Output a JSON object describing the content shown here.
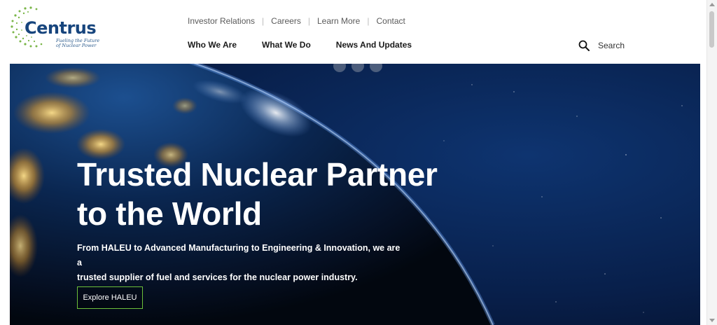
{
  "brand": {
    "name": "Centrus",
    "tagline_line1": "Fueling the Future",
    "tagline_line2": "of Nuclear Power",
    "primary_color": "#17457d",
    "accent_color": "#6cbf3a"
  },
  "utility_nav": [
    {
      "label": "Investor Relations"
    },
    {
      "label": "Careers"
    },
    {
      "label": "Learn More"
    },
    {
      "label": "Contact"
    }
  ],
  "main_nav": [
    {
      "label": "Who We Are"
    },
    {
      "label": "What We Do"
    },
    {
      "label": "News And Updates"
    }
  ],
  "search": {
    "label": "Search",
    "icon": "search-icon"
  },
  "hero": {
    "title_line1": "Trusted Nuclear Partner",
    "title_line2": "to the World",
    "subtitle_line1": "From HALEU to Advanced Manufacturing to Engineering & Innovation, we are a",
    "subtitle_line2": "trusted supplier of fuel and services for the nuclear power industry.",
    "cta_label": "Explore HALEU"
  }
}
